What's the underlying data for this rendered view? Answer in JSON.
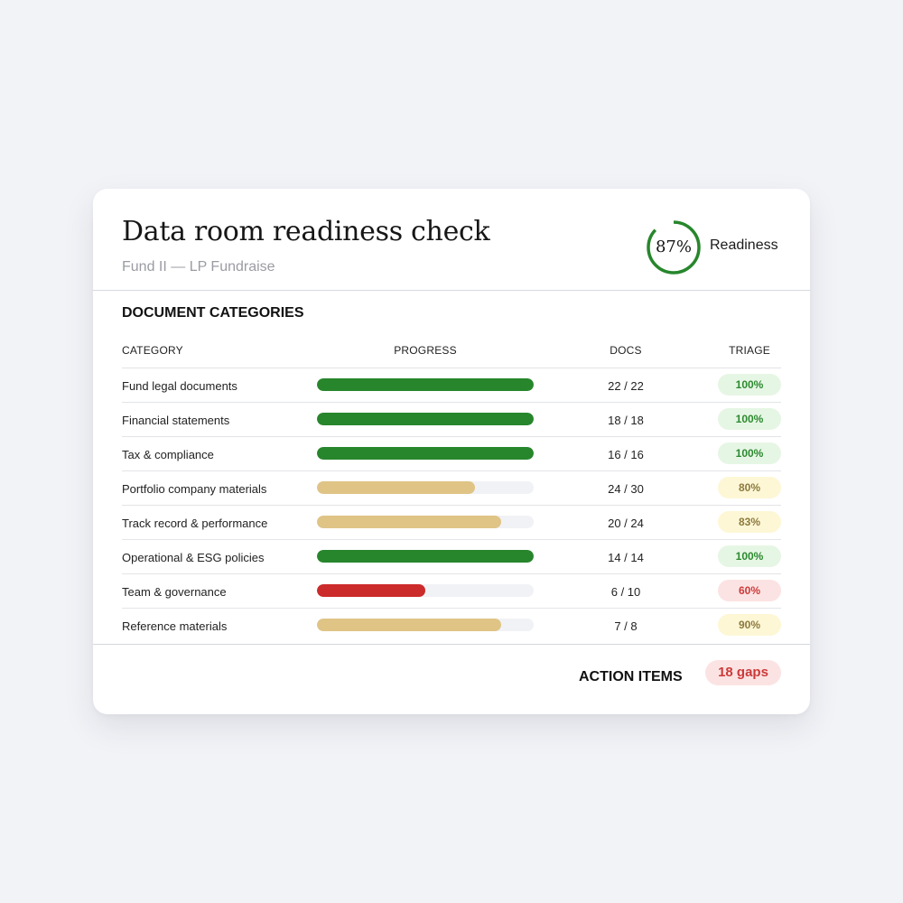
{
  "header": {
    "title": "Data room readiness check",
    "subtitle": "Fund II — LP Fundraise",
    "readiness_value": "87%",
    "readiness_fraction": 0.87,
    "readiness_label": "Readiness"
  },
  "section_title": "DOCUMENT CATEGORIES",
  "columns": {
    "category": "CATEGORY",
    "progress": "PROGRESS",
    "docs": "DOCS",
    "triage": "TRIAGE"
  },
  "status_colors": {
    "complete": {
      "bar": "#27862c",
      "badge_bg": "#e6f6e4",
      "badge_text": "#2c8a30"
    },
    "partial": {
      "bar": "#dfc486",
      "badge_bg": "#fdf7d6",
      "badge_text": "#8d7a3e"
    },
    "critical": {
      "bar": "#cc2b2b",
      "badge_bg": "#fce3e3",
      "badge_text": "#cc3a3a"
    }
  },
  "rows": [
    {
      "category": "Fund legal documents",
      "docs": "22 / 22",
      "triage": "100%",
      "progress": 1.0,
      "status": "complete"
    },
    {
      "category": "Financial statements",
      "docs": "18 / 18",
      "triage": "100%",
      "progress": 1.0,
      "status": "complete"
    },
    {
      "category": "Tax & compliance",
      "docs": "16 / 16",
      "triage": "100%",
      "progress": 1.0,
      "status": "complete"
    },
    {
      "category": "Portfolio company materials",
      "docs": "24 / 30",
      "triage": "80%",
      "progress": 0.73,
      "status": "partial"
    },
    {
      "category": "Track record & performance",
      "docs": "20 / 24",
      "triage": "83%",
      "progress": 0.85,
      "status": "partial"
    },
    {
      "category": "Operational & ESG policies",
      "docs": "14 / 14",
      "triage": "100%",
      "progress": 1.0,
      "status": "complete"
    },
    {
      "category": "Team & governance",
      "docs": "6 / 10",
      "triage": "60%",
      "progress": 0.5,
      "status": "critical"
    },
    {
      "category": "Reference materials",
      "docs": "7 / 8",
      "triage": "90%",
      "progress": 0.85,
      "status": "partial"
    }
  ],
  "footer": {
    "action_label": "ACTION ITEMS",
    "gaps_label": "18 gaps"
  }
}
